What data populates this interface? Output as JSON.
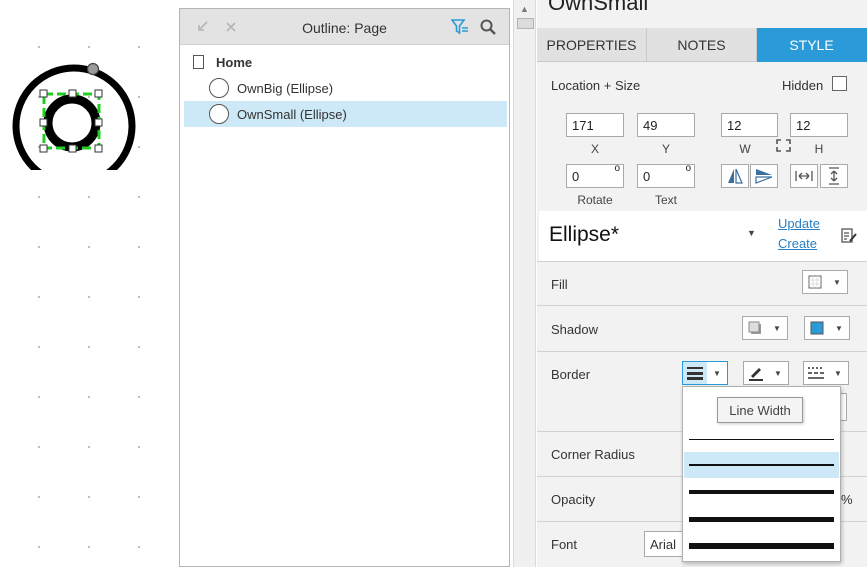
{
  "canvas": {
    "shapes": [
      {
        "name": "OwnBig",
        "type": "ellipse"
      },
      {
        "name": "OwnSmall",
        "type": "ellipse",
        "selected": true
      }
    ]
  },
  "outline": {
    "title": "Outline: Page",
    "page_name": "Home",
    "items": [
      {
        "label": "OwnBig (Ellipse)",
        "selected": false
      },
      {
        "label": "OwnSmall (Ellipse)",
        "selected": true
      }
    ]
  },
  "panel": {
    "title": "OwnSmall",
    "tabs": [
      {
        "label": "PROPERTIES",
        "active": false
      },
      {
        "label": "NOTES",
        "active": false
      },
      {
        "label": "STYLE",
        "active": true
      }
    ],
    "location_size_label": "Location + Size",
    "hidden_label": "Hidden",
    "hidden_checked": false,
    "x": "171",
    "y": "49",
    "w": "12",
    "h": "12",
    "x_label": "X",
    "y_label": "Y",
    "w_label": "W",
    "h_label": "H",
    "rotate": "0",
    "text_rotate": "0",
    "rotate_label": "Rotate",
    "text_label": "Text",
    "style_name": "Ellipse*",
    "update_link": "Update",
    "create_link": "Create",
    "fill_label": "Fill",
    "shadow_label": "Shadow",
    "border_label": "Border",
    "corner_radius_label": "Corner Radius",
    "opacity_label": "Opacity",
    "opacity_suffix": "%",
    "font_label": "Font",
    "font_value": "Arial",
    "shadow_color": "#2a9bd8"
  },
  "line_width_menu": {
    "tooltip": "Line Width",
    "options": [
      {
        "width": 1,
        "selected": false
      },
      {
        "width": 2,
        "selected": true
      },
      {
        "width": 3,
        "selected": false
      },
      {
        "width": 4,
        "selected": false
      },
      {
        "width": 5,
        "selected": false
      }
    ]
  }
}
